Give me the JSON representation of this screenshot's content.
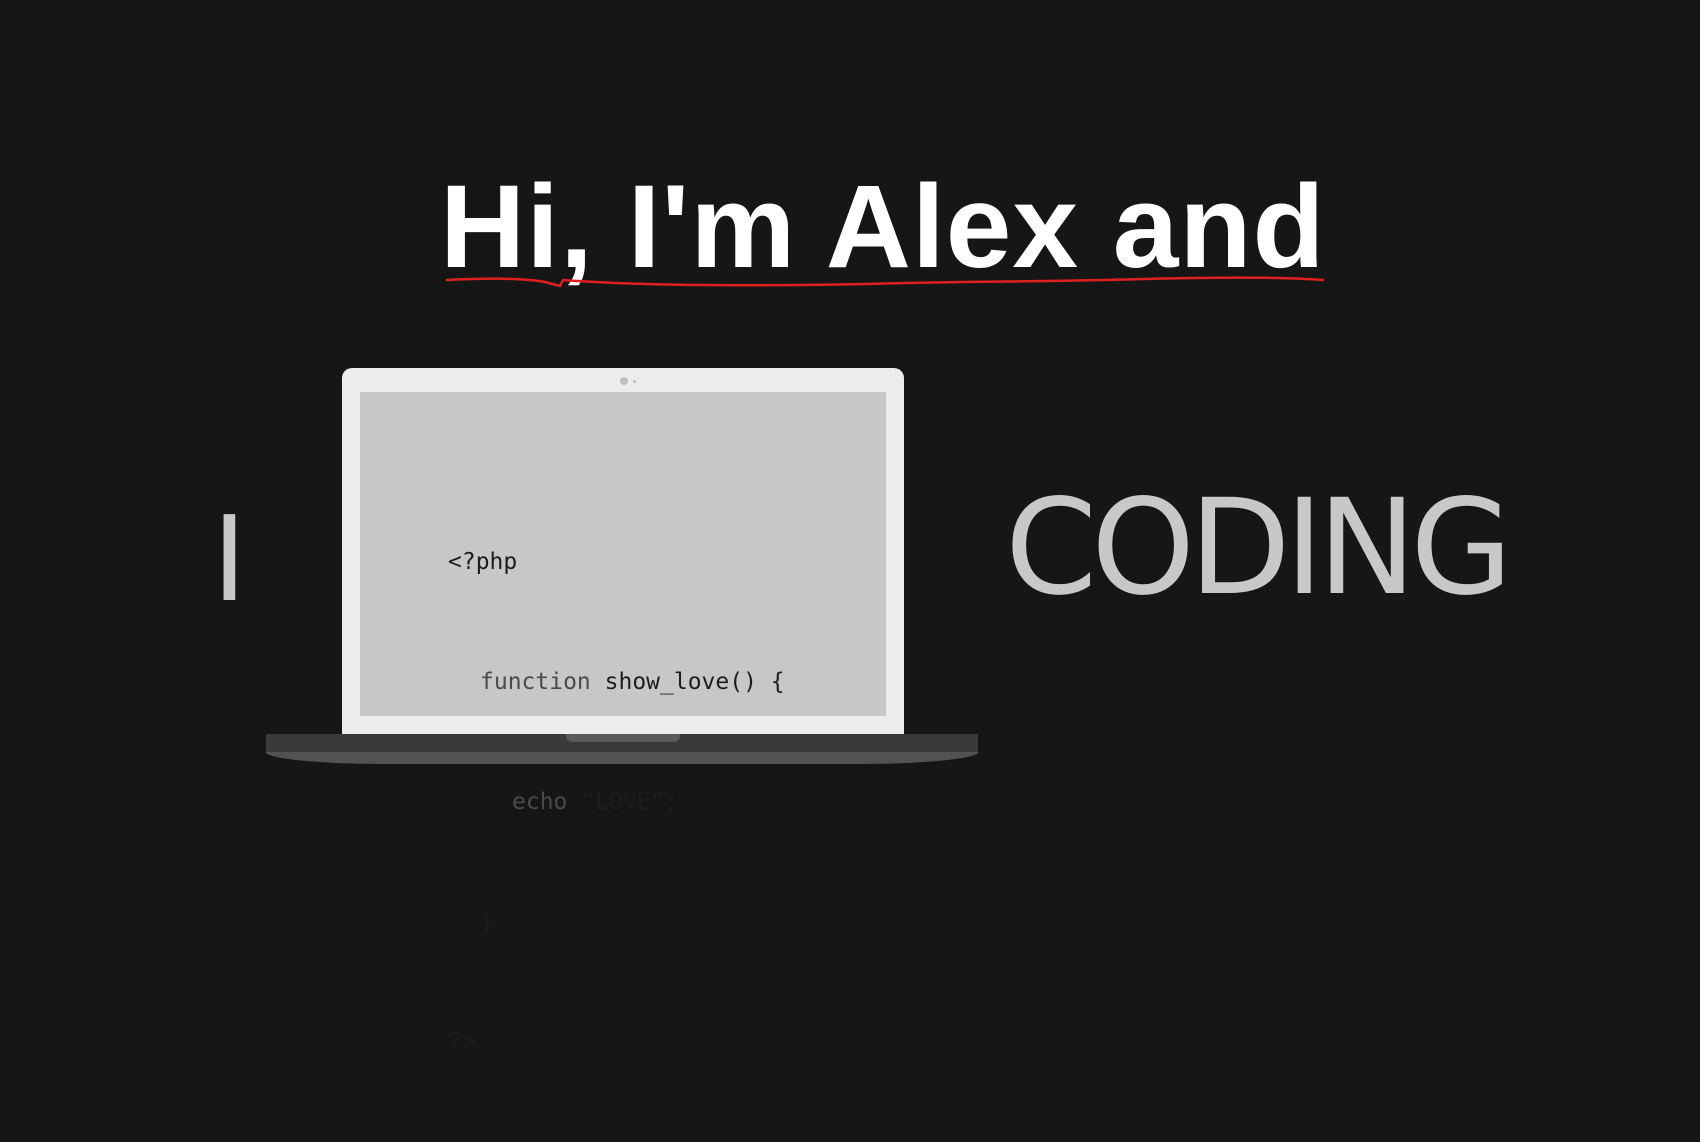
{
  "headline": "Hi, I'm Alex and",
  "left_word": "I",
  "right_word": "CODING",
  "code_lines": {
    "line1": "<?php",
    "line2_keyword": "function ",
    "line2_rest": "show_love() {",
    "line3_keyword": "echo ",
    "line3_rest": "“LOVE”;",
    "line4": "}",
    "line5": "?>"
  },
  "colors": {
    "background": "#161616",
    "headline": "#ffffff",
    "underline": "#e02020",
    "gray_text": "#c8c8c8",
    "screen": "#c7c7c7",
    "lid": "#ececec"
  }
}
